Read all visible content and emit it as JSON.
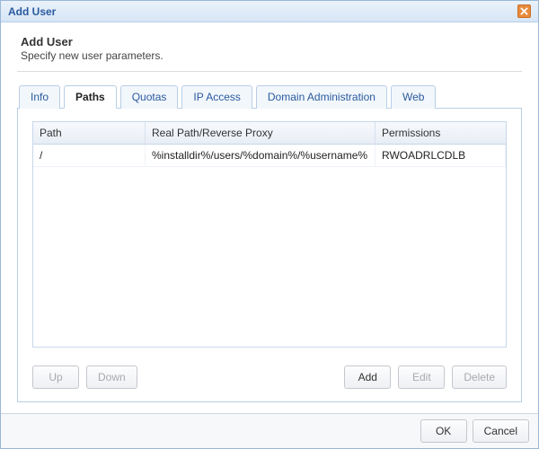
{
  "window": {
    "title": "Add User"
  },
  "header": {
    "title": "Add User",
    "subtitle": "Specify new user parameters."
  },
  "tabs": {
    "info": {
      "label": "Info"
    },
    "paths": {
      "label": "Paths"
    },
    "quotas": {
      "label": "Quotas"
    },
    "ip": {
      "label": "IP Access"
    },
    "domain": {
      "label": "Domain Administration"
    },
    "web": {
      "label": "Web"
    },
    "active": "paths"
  },
  "grid": {
    "headers": {
      "path": "Path",
      "real": "Real Path/Reverse Proxy",
      "perm": "Permissions"
    },
    "rows": [
      {
        "path": "/",
        "real": "%installdir%/users/%domain%/%username%",
        "perm": "RWOADRLCDLB"
      }
    ]
  },
  "buttons": {
    "up": "Up",
    "down": "Down",
    "add": "Add",
    "edit": "Edit",
    "delete": "Delete",
    "ok": "OK",
    "cancel": "Cancel"
  }
}
